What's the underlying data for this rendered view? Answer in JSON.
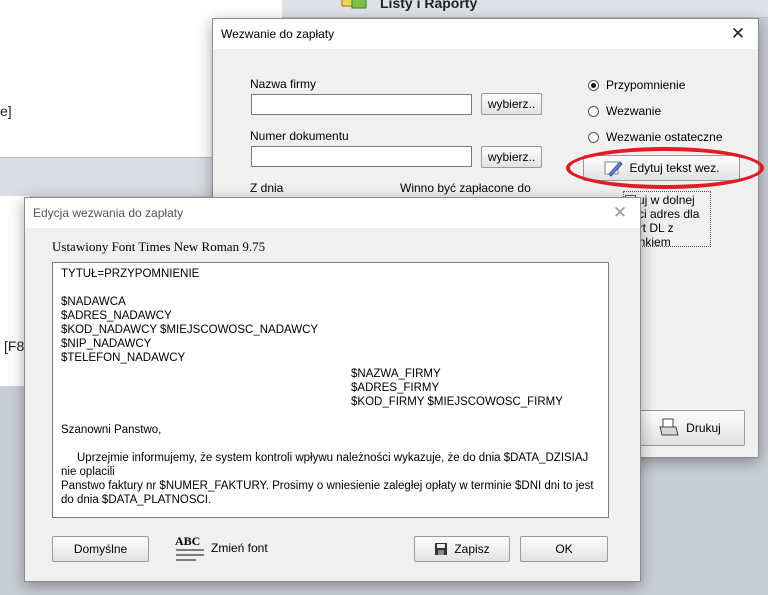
{
  "background": {
    "toolbar_label": "Listy i Raporty",
    "left_fragment_1": "e]",
    "left_fragment_2": "[F8"
  },
  "wezwanie_window": {
    "title": "Wezwanie do zapłaty",
    "firma_label": "Nazwa firmy",
    "firma_value": "",
    "firma_button": "wybierz..",
    "dokument_label": "Numer dokumentu",
    "dokument_value": "",
    "dokument_button": "wybierz..",
    "z_dnia_label": "Z dnia",
    "winno_label": "Winno być zapłacone do",
    "radios": [
      {
        "label": "Przypomnienie",
        "selected": true
      },
      {
        "label": "Wezwanie",
        "selected": false
      },
      {
        "label": "Wezwanie ostateczne",
        "selected": false
      }
    ],
    "edit_button": "Edytuj tekst wez.",
    "checkbox_text": "kuj w dolnej\nści adres dla\nert DL z\nenkiem",
    "print_button": "Drukuj",
    "highlight_color": "#e01c24"
  },
  "edycja_window": {
    "title": "Edycja wezwania do zapłaty",
    "font_info": "Ustawiony Font Times New Roman  9.75",
    "text_lines": {
      "tytul": "TYTUŁ=PRZYPOMNIENIE",
      "nadawca": "$NADAWCA",
      "adres_nadawcy": "$ADRES_NADAWCY",
      "kod_nadawcy": "$KOD_NADAWCY $MIEJSCOWOSC_NADAWCY",
      "nip_nadawcy": "$NIP_NADAWCY",
      "telefon_nadawcy": "$TELEFON_NADAWCY",
      "nazwa_firmy": "$NAZWA_FIRMY",
      "adres_firmy": "$ADRES_FIRMY",
      "kod_firmy": "$KOD_FIRMY $MIEJSCOWOSC_FIRMY",
      "powitanie": "Szanowni Panstwo,",
      "akapit1": "Uprzejmie informujemy, że system kontroli wpływu należności wykazuje, że do dnia $DATA_DZISIAJ nie oplacili",
      "akapit2": "Panstwo faktury nr $NUMER_FAKTURY. Prosimy o wniesienie zaległej opłaty w terminie $DNI dni to jest do dnia $DATA_PLATNOSCI."
    },
    "buttons": {
      "domyslne": "Domyślne",
      "abc": "ABC",
      "zmien_font": "Zmień font",
      "zapisz": "Zapisz",
      "ok": "OK"
    }
  }
}
